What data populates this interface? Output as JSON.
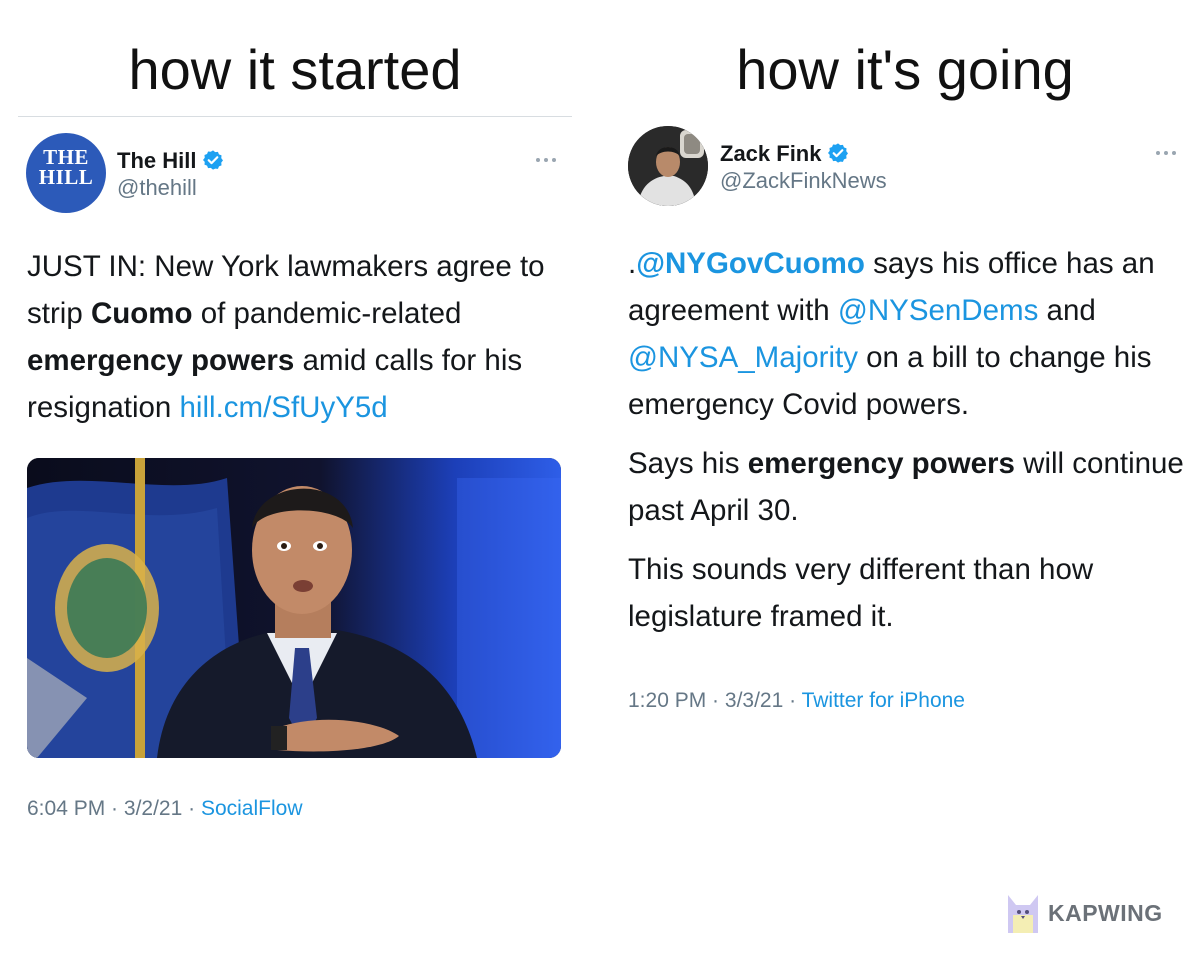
{
  "headings": {
    "left": "how it started",
    "right": "how it's going"
  },
  "tweet_left": {
    "avatar_text_line1": "THE",
    "avatar_text_line2": "HILL",
    "name": "The Hill",
    "handle": "@thehill",
    "text": {
      "p1": "JUST IN: New York lawmakers agree to strip ",
      "b1": "Cuomo",
      "p2": " of pandemic-related ",
      "b2": "emergency powers",
      "p3": " amid calls for his resignation ",
      "link": "hill.cm/SfUyY5d"
    },
    "time": "6:04 PM",
    "date": "3/2/21",
    "source": "SocialFlow"
  },
  "tweet_right": {
    "name": "Zack Fink",
    "handle": "@ZackFinkNews",
    "para1": {
      "lead": ".",
      "mention1": "@NYGovCuomo",
      "t1": " says his office has an agreement with ",
      "mention2": "@NYSenDems",
      "t2": " and ",
      "mention3": "@NYSA_Majority",
      "t3": " on a bill to change his emergency Covid powers."
    },
    "para2": {
      "t1": "Says his ",
      "b1": "emergency powers",
      "t2": " will continue past April 30."
    },
    "para3": "This sounds very different than how legislature framed it.",
    "time": "1:20 PM",
    "date": "3/3/21",
    "source": "Twitter for iPhone"
  },
  "watermark": "KAPWING",
  "colors": {
    "link": "#1b95e0",
    "verified": "#1da1f2",
    "muted": "#657786",
    "hill_blue": "#2c5ab9"
  },
  "icons": {
    "verified": "verified-badge-icon",
    "more": "more-options-icon"
  },
  "meta_separator": " · "
}
